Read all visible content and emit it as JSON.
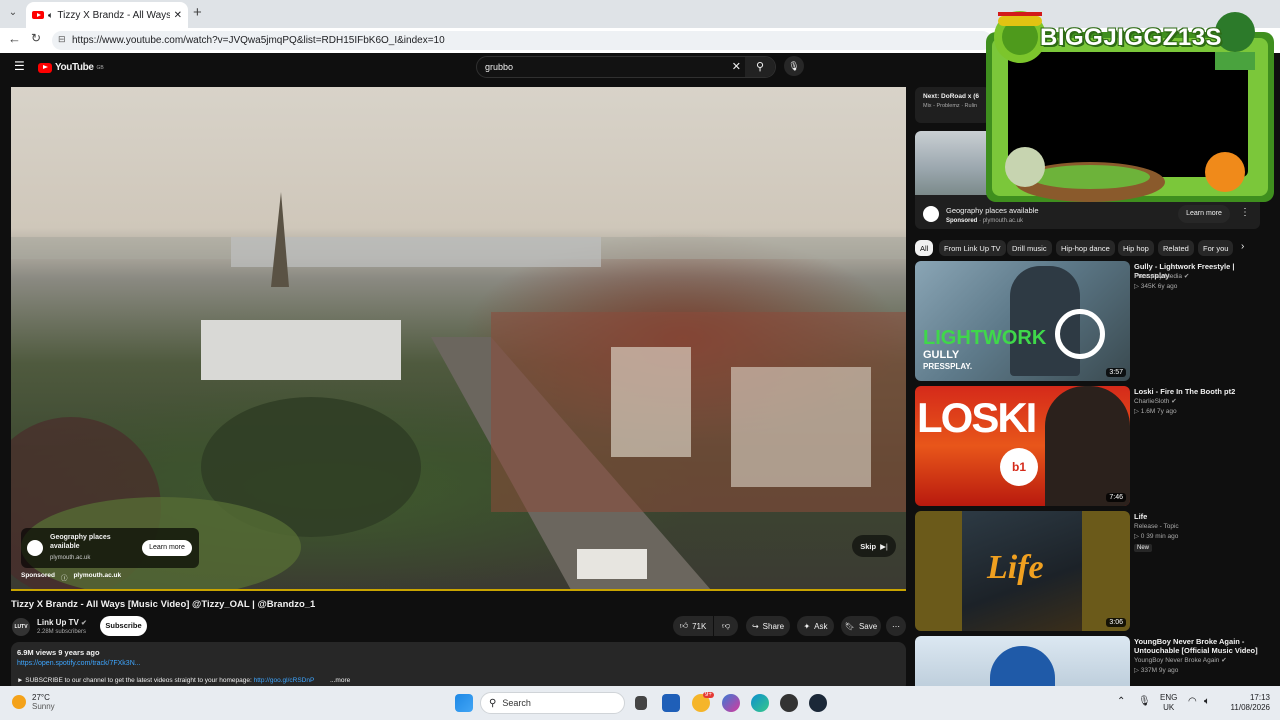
{
  "browser": {
    "tab_title": "Tizzy X Brandz - All Ways [Mu",
    "url": "https://www.youtube.com/watch?v=JVQwa5jmqPQ&list=RDH15IFbK6O_I&index=10"
  },
  "youtube": {
    "logo_text": "YouTube",
    "logo_region": "GB",
    "search_value": "grubbo",
    "ad": {
      "title": "Geography places available",
      "domain": "plymouth.ac.uk",
      "button": "Learn more",
      "sponsored": "Sponsored",
      "skip": "Skip"
    },
    "video": {
      "title": "Tizzy X Brandz - All Ways [Music Video] @Tizzy_OAL | @Brandzo_1",
      "channel": "Link Up TV",
      "subscribers": "2.28M subscribers",
      "subscribe": "Subscribe",
      "likes": "71K",
      "share": "Share",
      "ask": "Ask",
      "save": "Save",
      "views_date": "6.9M views  9 years ago",
      "description_link": "https://open.spotify.com/track/7FXk3N...",
      "description_line": "► SUBSCRIBE to our channel to get the latest videos straight to your homepage: ",
      "description_link2": "http://goo.gl/cRSDnP",
      "more": "...more"
    },
    "up_next": {
      "label": "Next: DoRoad x (6",
      "meta": "Mix - Problemz · Rulin"
    },
    "side_ad": {
      "title": "Geography places available",
      "sponsored": "Sponsored",
      "domain": "plymouth.ac.uk",
      "button": "Learn more"
    },
    "chips": [
      "All",
      "From Link Up TV",
      "Drill music",
      "Hip-hop dance",
      "Hip hop",
      "Related",
      "For you"
    ],
    "recommendations": [
      {
        "title": "Gully - Lightwork Freestyle | Pressplay",
        "channel": "Pressplay Media",
        "meta": "▷ 345K  6y ago",
        "duration": "3:57",
        "thumb_text": "LIGHTWORK",
        "thumb_sub1": "GULLY",
        "thumb_sub2": "PRESSPLAY."
      },
      {
        "title": "Loski - Fire In The Booth pt2",
        "channel": "CharlieSloth",
        "meta": "▷ 1.6M  7y ago",
        "duration": "7:46",
        "thumb_text": "LOSKI"
      },
      {
        "title": "Life",
        "channel": "Release - Topic",
        "meta": "▷ 0  39 min ago",
        "badge": "New",
        "duration": "3:06",
        "thumb_text": "Life"
      },
      {
        "title": "YoungBoy Never Broke Again - Untouchable [Official Music Video]",
        "channel": "YoungBoy Never Broke Again",
        "meta": "▷ 337M  9y ago"
      }
    ]
  },
  "overlay": {
    "name": "BIGGJIGGZ13S"
  },
  "taskbar": {
    "temp": "27°C",
    "weather": "Sunny",
    "search_placeholder": "Search",
    "lang1": "ENG",
    "lang2": "UK",
    "time": "17:13",
    "date": "11/08/2026",
    "badge": "9+"
  },
  "colors": {
    "yt_bg": "#0f0f0f",
    "yt_red": "#ff0000",
    "progress": "#c9a400",
    "overlay_green": "#6ac42b"
  }
}
